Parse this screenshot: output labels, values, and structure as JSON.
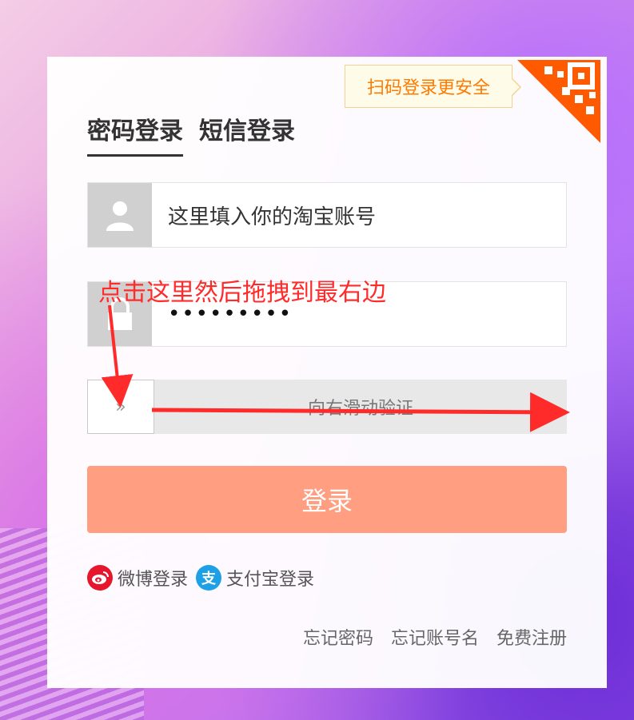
{
  "qr": {
    "tip": "扫码登录更安全"
  },
  "tabs": [
    {
      "label": "密码登录",
      "active": true
    },
    {
      "label": "短信登录",
      "active": false
    }
  ],
  "form": {
    "username_value": "这里填入你的淘宝账号",
    "password_mask": "•••••••••"
  },
  "slider": {
    "label": "向右滑动验证",
    "handle_glyph": "»"
  },
  "login_button": {
    "label": "登录"
  },
  "social": {
    "weibo": "微博登录",
    "alipay": "支付宝登录",
    "alipay_glyph": "支"
  },
  "links": {
    "forgot_password": "忘记密码",
    "forgot_account": "忘记账号名",
    "register": "免费注册"
  },
  "annotation": {
    "text": "点击这里然后拖拽到最右边"
  },
  "colors": {
    "accent": "#ff7a00",
    "button": "#ff9e80",
    "annotation": "#ff2a2a"
  }
}
